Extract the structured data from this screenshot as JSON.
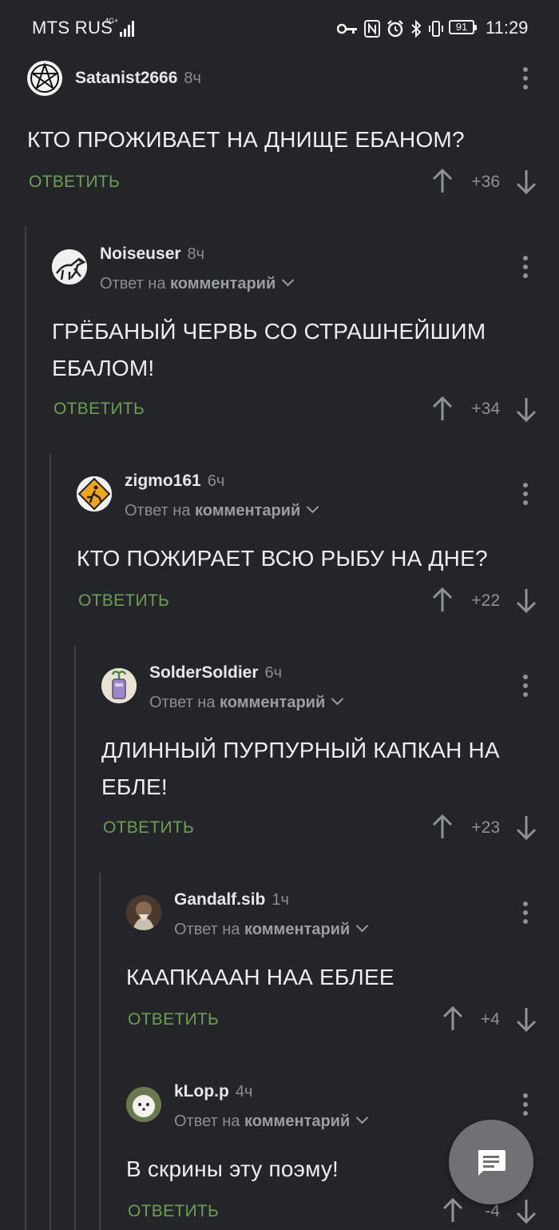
{
  "status_bar": {
    "carrier": "MTS RUS",
    "network": "4G+",
    "battery": "91",
    "time": "11:29"
  },
  "comments": [
    {
      "username": "Satanist2666",
      "time": "8ч",
      "text": "КТО ПРОЖИВАЕТ НА ДНИЩЕ ЕБАНОМ?",
      "reply_label": "ОТВЕТИТЬ",
      "score": "+36"
    },
    {
      "username": "Noiseuser",
      "time": "8ч",
      "reply_prefix": "Ответ на",
      "reply_target": "комментарий",
      "text_line1": "ГРЁБАНЫЙ ЧЕРВЬ СО СТРАШНЕЙШИМ",
      "text_line2": "ЕБАЛОМ!",
      "reply_label": "ОТВЕТИТЬ",
      "score": "+34"
    },
    {
      "username": "zigmo161",
      "time": "6ч",
      "reply_prefix": "Ответ на",
      "reply_target": "комментарий",
      "text": "КТО ПОЖИРАЕТ ВСЮ РЫБУ НА ДНЕ?",
      "reply_label": "ОТВЕТИТЬ",
      "score": "+22"
    },
    {
      "username": "SolderSoldier",
      "time": "6ч",
      "reply_prefix": "Ответ на",
      "reply_target": "комментарий",
      "text_line1": "ДЛИННЫЙ ПУРПУРНЫЙ КАПКАН НА",
      "text_line2": "ЕБЛЕ!",
      "reply_label": "ОТВЕТИТЬ",
      "score": "+23"
    },
    {
      "username": "Gandalf.sib",
      "time": "1ч",
      "reply_prefix": "Ответ на",
      "reply_target": "комментарий",
      "text": "КААПКААAН НАА ЕБЛЕЕ",
      "reply_label": "ОТВЕТИТЬ",
      "score": "+4"
    },
    {
      "username": "kLop.p",
      "time": "4ч",
      "reply_prefix": "Ответ на",
      "reply_target": "комментарий",
      "text": "В скрины эту поэму!",
      "reply_label": "ОТВЕТИТЬ",
      "score": "-4"
    }
  ],
  "colors": {
    "background": "#232528",
    "reply_green": "#6e9e55",
    "muted_gray": "#8a8d92"
  }
}
